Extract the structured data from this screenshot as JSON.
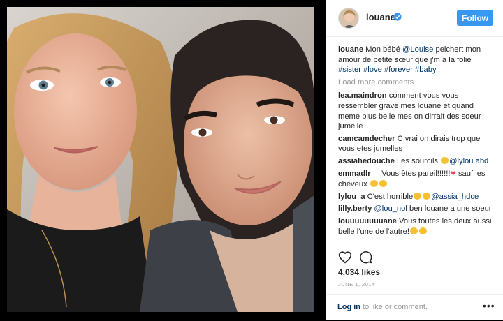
{
  "post": {
    "username": "louane",
    "follow_label": "Follow",
    "caption": {
      "user": "louane",
      "text_a": " Mon bébé ",
      "mention": "@Louise",
      "text_b": " peichert mon amour de petite sœur que j'm a la folie ",
      "hashtags": "#sister #love #forever #baby"
    },
    "load_more": "Load more comments",
    "comments": [
      {
        "user": "lea.maindron",
        "text": " comment vous vous ressembler grave mes louane et quand meme plus belle mes on dirrait des soeur jumelle"
      },
      {
        "user": "camcamdecher",
        "text": " C vrai on dirais trop que vous etes jumelles"
      },
      {
        "user": "assiahedouche",
        "text_a": " Les sourcils ",
        "mention": "@lylou.abd"
      },
      {
        "user": "emmadlr__",
        "text_a": " Vous êtes pareil!!!!!!",
        "text_b": " sauf les cheveux "
      },
      {
        "user": "lylou_a",
        "text_a": " C'est horrible",
        "mention": "@assia_hdce"
      },
      {
        "user": "lilly.berty",
        "mention": "@lou_nol",
        "text_b": " ben louane a une soeur"
      },
      {
        "user": "louuuuuuuuane",
        "text": " Vous toutes les deux aussi belle l'une de l'autre!"
      }
    ],
    "likes": "4,034 likes",
    "date": "JUNE 1, 2014",
    "login_link": "Log in",
    "login_text": " to like or comment.",
    "more_options": "•••"
  },
  "icons": [
    "verified-badge-icon",
    "heart-icon",
    "comment-icon",
    "more-options-icon"
  ],
  "colors": {
    "follow": "#3897f0",
    "link": "#003569",
    "muted": "#999999"
  }
}
